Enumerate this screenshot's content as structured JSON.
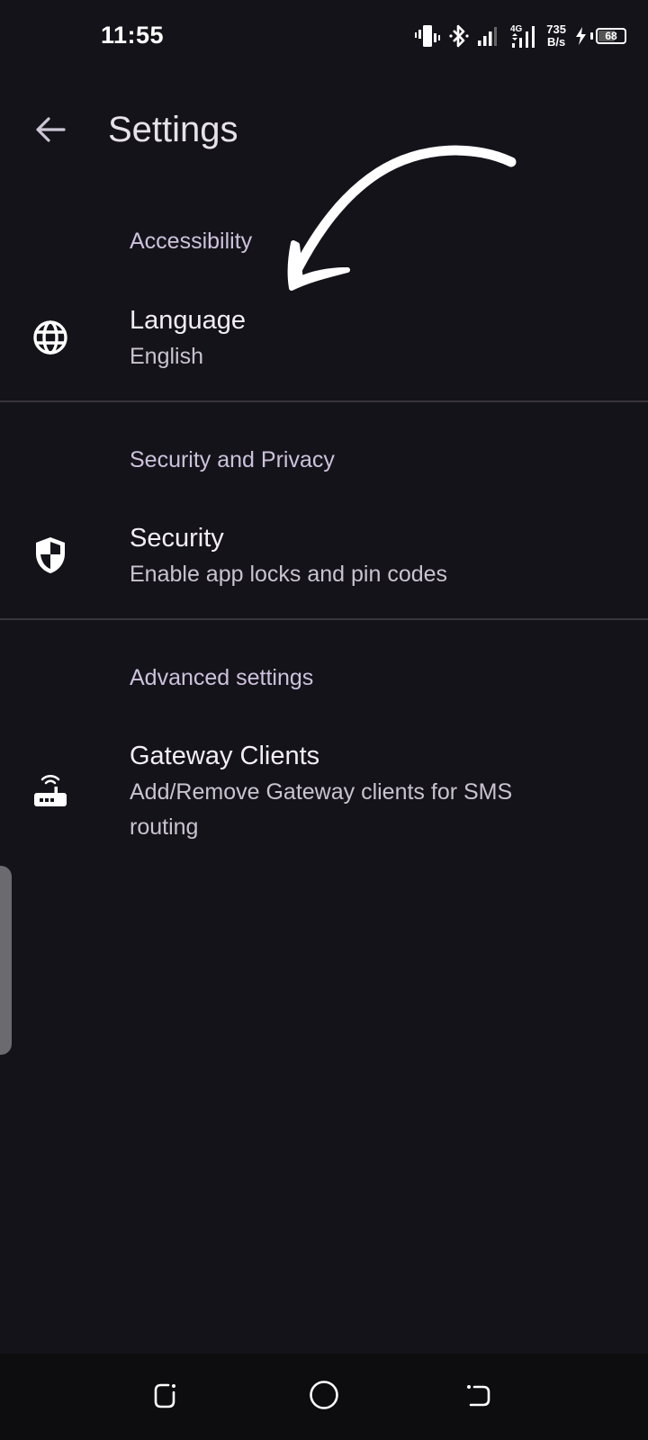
{
  "status_bar": {
    "time": "11:55",
    "icons": [
      "vibrate-icon",
      "bluetooth-icon",
      "signal-sim1-icon",
      "signal-4g-icon"
    ],
    "network_type": "4G",
    "net_speed_value": "735",
    "net_speed_unit": "B/s",
    "battery_level": "68",
    "battery_charging": true
  },
  "app_bar": {
    "back_icon": "arrow-back-icon",
    "title": "Settings"
  },
  "sections": [
    {
      "header": "Accessibility",
      "items": [
        {
          "icon": "globe-icon",
          "title": "Language",
          "summary": "English"
        }
      ]
    },
    {
      "header": "Security and Privacy",
      "items": [
        {
          "icon": "shield-icon",
          "title": "Security",
          "summary": "Enable app locks and pin codes"
        }
      ]
    },
    {
      "header": "Advanced settings",
      "items": [
        {
          "icon": "router-icon",
          "title": "Gateway Clients",
          "summary": "Add/Remove Gateway clients for SMS routing"
        }
      ]
    }
  ],
  "annotation": {
    "type": "hand-drawn-arrow",
    "color": "#ffffff",
    "points_to": "Accessibility"
  },
  "nav_bar": {
    "buttons": [
      "recents",
      "home",
      "back"
    ]
  },
  "colors": {
    "background": "#15131a",
    "section_header": "#cdc2dc",
    "title_text": "#f2eef5",
    "summary_text": "#c9c3cf",
    "divider": "#38353e",
    "nav_background": "#0d0d0f"
  }
}
